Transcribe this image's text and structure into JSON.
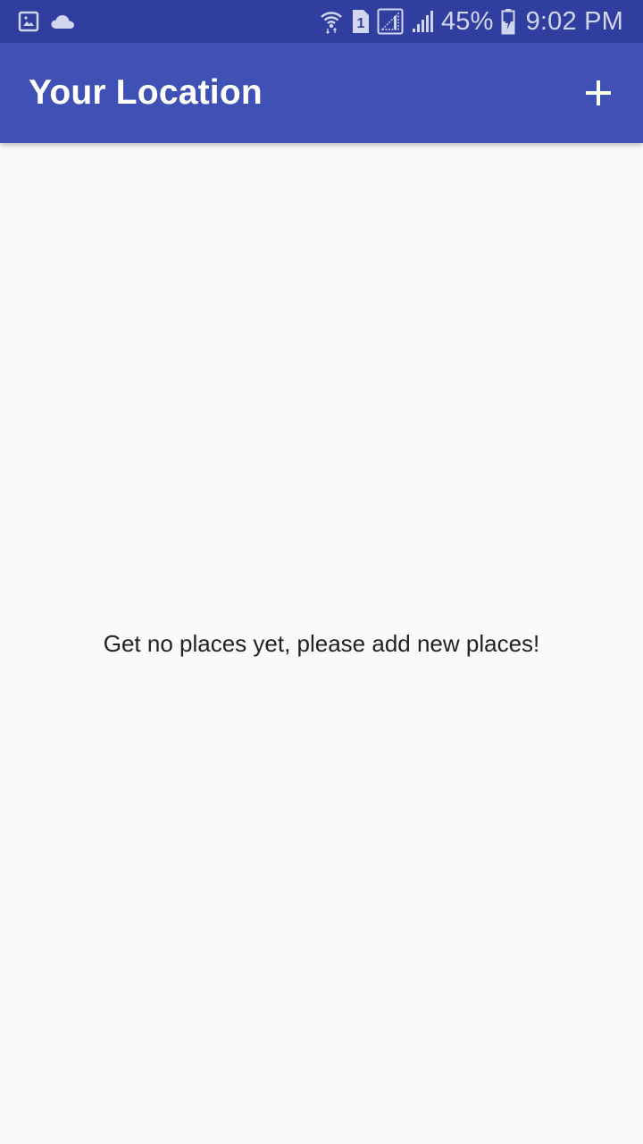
{
  "status_bar": {
    "battery": "45%",
    "time": "9:02 PM",
    "sim_slot": "1",
    "icons": [
      "gallery-icon",
      "cloud-icon",
      "wifi-icon",
      "sim-icon",
      "signal-icon",
      "signal-icon",
      "battery-charging-icon"
    ]
  },
  "app_bar": {
    "title": "Your Location",
    "add_icon": "plus-icon"
  },
  "main": {
    "empty_message": "Get no places yet, please add new places!"
  },
  "colors": {
    "status_bar": "#303f9f",
    "app_bar": "#3f51b5",
    "background": "#fafafa",
    "text": "#212121"
  }
}
